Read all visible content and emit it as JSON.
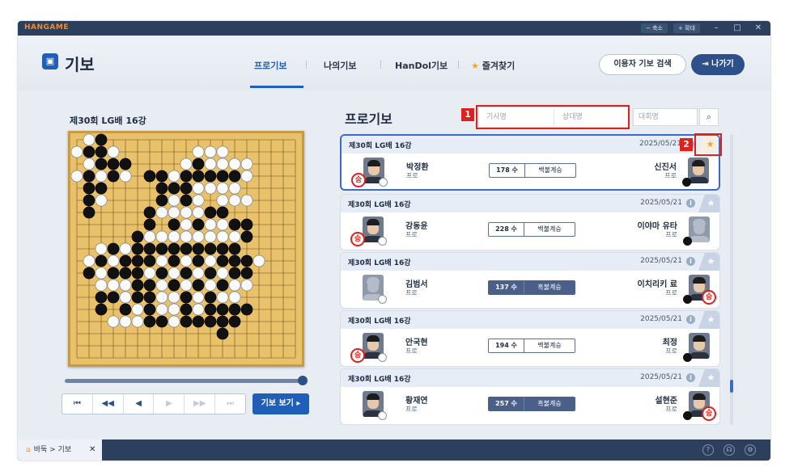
{
  "window": {
    "brand": "HANGAME",
    "zoom_out": "− 축소",
    "zoom_in": "+ 확대"
  },
  "header": {
    "title": "기보",
    "tabs": [
      {
        "label": "프로기보",
        "active": true
      },
      {
        "label": "나의기보",
        "active": false
      },
      {
        "label": "HanDol기보",
        "active": false
      },
      {
        "label": "즐겨찾기",
        "active": false
      }
    ],
    "search_user_button": "이용자 기보 검색",
    "exit_button": "나가기"
  },
  "board_panel": {
    "title": "제30회 LG배 16강",
    "view_button": "기보 보기 ▸",
    "controls": [
      "first-move",
      "prev-10",
      "prev",
      "next",
      "next-10",
      "last-move"
    ]
  },
  "list_panel": {
    "title": "프로기보",
    "search": {
      "player_placeholder": "기사명",
      "opponent_placeholder": "상대명",
      "tournament_placeholder": "대회명"
    },
    "annotations": [
      "1",
      "2"
    ],
    "games": [
      {
        "title": "제30회 LG배 16강",
        "date": "2025/05/21",
        "favorite": true,
        "selected": true,
        "left": {
          "name": "박정환",
          "rank": "프로",
          "stone": "white",
          "win": true,
          "photo": true
        },
        "moves": "178 수",
        "result": "백불계승",
        "dark": false,
        "right": {
          "name": "신진서",
          "rank": "프로",
          "stone": "black",
          "win": false,
          "photo": true
        }
      },
      {
        "title": "제30회 LG배 16강",
        "date": "2025/05/21",
        "favorite": false,
        "selected": false,
        "left": {
          "name": "강동윤",
          "rank": "프로",
          "stone": "white",
          "win": true,
          "photo": true
        },
        "moves": "228 수",
        "result": "백불계승",
        "dark": false,
        "right": {
          "name": "이야마 유타",
          "rank": "프로",
          "stone": "black",
          "win": false,
          "photo": false
        }
      },
      {
        "title": "제30회 LG배 16강",
        "date": "2025/05/21",
        "favorite": false,
        "selected": false,
        "left": {
          "name": "김범서",
          "rank": "프로",
          "stone": "white",
          "win": false,
          "photo": false
        },
        "moves": "137 수",
        "result": "흑불계승",
        "dark": true,
        "right": {
          "name": "이치리키 료",
          "rank": "프로",
          "stone": "black",
          "win": true,
          "photo": true
        }
      },
      {
        "title": "제30회 LG배 16강",
        "date": "2025/05/21",
        "favorite": false,
        "selected": false,
        "left": {
          "name": "안국현",
          "rank": "프로",
          "stone": "white",
          "win": true,
          "photo": true
        },
        "moves": "194 수",
        "result": "백불계승",
        "dark": false,
        "right": {
          "name": "최정",
          "rank": "프로",
          "stone": "black",
          "win": false,
          "photo": true
        }
      },
      {
        "title": "제30회 LG배 16강",
        "date": "2025/05/21",
        "favorite": false,
        "selected": false,
        "left": {
          "name": "황재연",
          "rank": "프로",
          "stone": "white",
          "win": false,
          "photo": true
        },
        "moves": "257 수",
        "result": "흑불계승",
        "dark": true,
        "right": {
          "name": "설현준",
          "rank": "프로",
          "stone": "black",
          "win": true,
          "photo": true
        }
      }
    ]
  },
  "bottom_bar": {
    "tab_label": "바둑 > 기보",
    "win_mark": "승"
  },
  "colors": {
    "accent": "#1f5fb8",
    "title_bar": "#2c3f5c",
    "highlight_red": "#e0211b",
    "board": "#e9c16a"
  }
}
